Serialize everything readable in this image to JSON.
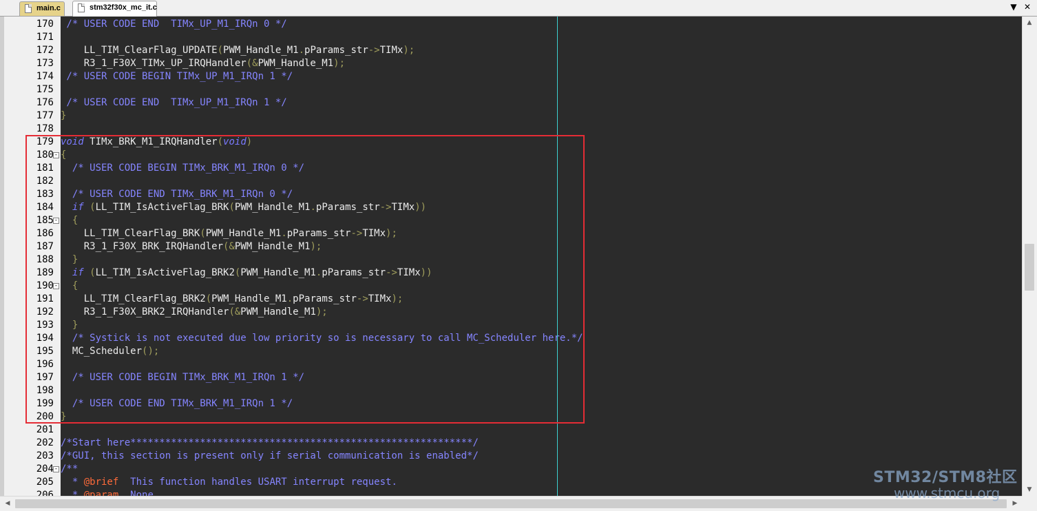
{
  "tabs": [
    {
      "label": "main.c",
      "active": false
    },
    {
      "label": "stm32f30x_mc_it.c",
      "active": true
    }
  ],
  "toolbar": {
    "dropdown_icon": "chevron-down-icon",
    "close_icon": "close-icon"
  },
  "editor": {
    "lines": [
      {
        "n": "170",
        "s": [
          [
            "cm",
            " /* USER CODE END  TIMx_UP_M1_IRQn 0 */"
          ]
        ]
      },
      {
        "n": "171",
        "s": []
      },
      {
        "n": "172",
        "s": [
          [
            "tx",
            "    LL_TIM_ClearFlag_UPDATE"
          ],
          [
            "op",
            "("
          ],
          [
            "tx",
            "PWM_Handle_M1"
          ],
          [
            "op",
            "."
          ],
          [
            "tx",
            "pParams_str"
          ],
          [
            "op",
            "->"
          ],
          [
            "tx",
            "TIMx"
          ],
          [
            "op",
            ");"
          ]
        ]
      },
      {
        "n": "173",
        "s": [
          [
            "tx",
            "    R3_1_F30X_TIMx_UP_IRQHandler"
          ],
          [
            "op",
            "(&"
          ],
          [
            "tx",
            "PWM_Handle_M1"
          ],
          [
            "op",
            ");"
          ]
        ]
      },
      {
        "n": "174",
        "s": [
          [
            "cm",
            " /* USER CODE BEGIN TIMx_UP_M1_IRQn 1 */"
          ]
        ]
      },
      {
        "n": "175",
        "s": []
      },
      {
        "n": "176",
        "s": [
          [
            "cm",
            " /* USER CODE END  TIMx_UP_M1_IRQn 1 */"
          ]
        ]
      },
      {
        "n": "177",
        "s": [
          [
            "op",
            "}"
          ]
        ]
      },
      {
        "n": "178",
        "s": []
      },
      {
        "n": "179",
        "s": [
          [
            "kw",
            "void"
          ],
          [
            "tx",
            " TIMx_BRK_M1_IRQHandler"
          ],
          [
            "op",
            "("
          ],
          [
            "kw",
            "void"
          ],
          [
            "op",
            ")"
          ]
        ]
      },
      {
        "n": "180",
        "fold": "-",
        "s": [
          [
            "op",
            "{"
          ]
        ]
      },
      {
        "n": "181",
        "s": [
          [
            "cm",
            "  /* USER CODE BEGIN TIMx_BRK_M1_IRQn 0 */"
          ]
        ]
      },
      {
        "n": "182",
        "s": []
      },
      {
        "n": "183",
        "s": [
          [
            "cm",
            "  /* USER CODE END TIMx_BRK_M1_IRQn 0 */"
          ]
        ]
      },
      {
        "n": "184",
        "s": [
          [
            "tx",
            "  "
          ],
          [
            "kw",
            "if"
          ],
          [
            "tx",
            " "
          ],
          [
            "op",
            "("
          ],
          [
            "tx",
            "LL_TIM_IsActiveFlag_BRK"
          ],
          [
            "op",
            "("
          ],
          [
            "tx",
            "PWM_Handle_M1"
          ],
          [
            "op",
            "."
          ],
          [
            "tx",
            "pParams_str"
          ],
          [
            "op",
            "->"
          ],
          [
            "tx",
            "TIMx"
          ],
          [
            "op",
            "))"
          ]
        ]
      },
      {
        "n": "185",
        "fold": "-",
        "s": [
          [
            "op",
            "  {"
          ]
        ]
      },
      {
        "n": "186",
        "s": [
          [
            "tx",
            "    LL_TIM_ClearFlag_BRK"
          ],
          [
            "op",
            "("
          ],
          [
            "tx",
            "PWM_Handle_M1"
          ],
          [
            "op",
            "."
          ],
          [
            "tx",
            "pParams_str"
          ],
          [
            "op",
            "->"
          ],
          [
            "tx",
            "TIMx"
          ],
          [
            "op",
            ");"
          ]
        ]
      },
      {
        "n": "187",
        "s": [
          [
            "tx",
            "    R3_1_F30X_BRK_IRQHandler"
          ],
          [
            "op",
            "(&"
          ],
          [
            "tx",
            "PWM_Handle_M1"
          ],
          [
            "op",
            ");"
          ]
        ]
      },
      {
        "n": "188",
        "s": [
          [
            "op",
            "  }"
          ]
        ]
      },
      {
        "n": "189",
        "s": [
          [
            "tx",
            "  "
          ],
          [
            "kw",
            "if"
          ],
          [
            "tx",
            " "
          ],
          [
            "op",
            "("
          ],
          [
            "tx",
            "LL_TIM_IsActiveFlag_BRK2"
          ],
          [
            "op",
            "("
          ],
          [
            "tx",
            "PWM_Handle_M1"
          ],
          [
            "op",
            "."
          ],
          [
            "tx",
            "pParams_str"
          ],
          [
            "op",
            "->"
          ],
          [
            "tx",
            "TIMx"
          ],
          [
            "op",
            "))"
          ]
        ]
      },
      {
        "n": "190",
        "fold": "-",
        "s": [
          [
            "op",
            "  {"
          ]
        ]
      },
      {
        "n": "191",
        "s": [
          [
            "tx",
            "    LL_TIM_ClearFlag_BRK2"
          ],
          [
            "op",
            "("
          ],
          [
            "tx",
            "PWM_Handle_M1"
          ],
          [
            "op",
            "."
          ],
          [
            "tx",
            "pParams_str"
          ],
          [
            "op",
            "->"
          ],
          [
            "tx",
            "TIMx"
          ],
          [
            "op",
            ");"
          ]
        ]
      },
      {
        "n": "192",
        "s": [
          [
            "tx",
            "    R3_1_F30X_BRK2_IRQHandler"
          ],
          [
            "op",
            "(&"
          ],
          [
            "tx",
            "PWM_Handle_M1"
          ],
          [
            "op",
            ");"
          ]
        ]
      },
      {
        "n": "193",
        "s": [
          [
            "op",
            "  }"
          ]
        ]
      },
      {
        "n": "194",
        "s": [
          [
            "cm",
            "  /* Systick is not executed due low priority so is necessary to call MC_Scheduler here.*/"
          ]
        ]
      },
      {
        "n": "195",
        "s": [
          [
            "tx",
            "  MC_Scheduler"
          ],
          [
            "op",
            "();"
          ]
        ]
      },
      {
        "n": "196",
        "s": []
      },
      {
        "n": "197",
        "s": [
          [
            "cm",
            "  /* USER CODE BEGIN TIMx_BRK_M1_IRQn 1 */"
          ]
        ]
      },
      {
        "n": "198",
        "s": []
      },
      {
        "n": "199",
        "s": [
          [
            "cm",
            "  /* USER CODE END TIMx_BRK_M1_IRQn 1 */"
          ]
        ]
      },
      {
        "n": "200",
        "s": [
          [
            "op",
            "}"
          ]
        ]
      },
      {
        "n": "201",
        "s": []
      },
      {
        "n": "202",
        "s": [
          [
            "cm",
            "/*Start here***********************************************************/"
          ]
        ]
      },
      {
        "n": "203",
        "s": [
          [
            "cm",
            "/*GUI, this section is present only if serial communication is enabled*/"
          ]
        ]
      },
      {
        "n": "204",
        "fold": "-",
        "s": [
          [
            "cm",
            "/**"
          ]
        ]
      },
      {
        "n": "205",
        "s": [
          [
            "cm",
            "  * "
          ],
          [
            "doc",
            "@brief"
          ],
          [
            "cm",
            "  This function handles USART interrupt request."
          ]
        ]
      },
      {
        "n": "206",
        "s": [
          [
            "cm",
            "  * "
          ],
          [
            "doc",
            "@param"
          ],
          [
            "cm",
            "  None"
          ]
        ]
      }
    ]
  },
  "watermark": {
    "line1": "STM32/STM8社区",
    "line2": "www.stmcu.org"
  }
}
